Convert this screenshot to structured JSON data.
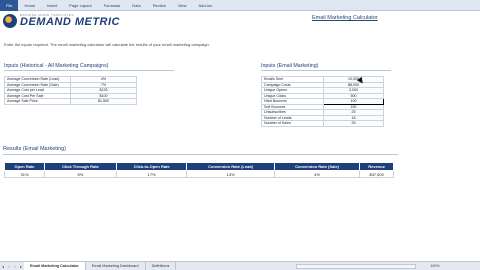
{
  "ribbon": {
    "tabs": [
      "File",
      "Home",
      "Insert",
      "Page Layout",
      "Formulas",
      "Data",
      "Review",
      "View",
      "Add-Ins"
    ]
  },
  "logo": {
    "tagline": "BROWSE MORE TEMPLATES",
    "name": "DEMAND METRIC"
  },
  "header": {
    "title": "Email Marketing Calculator",
    "intro": "Enter the inputs required. The email marketing calculator will calculate the results of your email marketing campaign."
  },
  "historical": {
    "title": "Inputs (Historical - All Marketing Campaigns)",
    "rows": [
      {
        "label": "Average Conversion Rate (Lead)",
        "value": "4%"
      },
      {
        "label": "Average Conversion Rate (Sale)",
        "value": "7%"
      },
      {
        "label": "Average Cost per Lead",
        "value": "$125"
      },
      {
        "label": "Average Cost Per Sale",
        "value": "$100"
      },
      {
        "label": "Average Sale Price",
        "value": "$1,500"
      }
    ]
  },
  "email_inputs": {
    "title": "Inputs (Email Marketing)",
    "rows": [
      {
        "label": "Emails Sent",
        "value": "10,000"
      },
      {
        "label": "Campaign Costs",
        "value": "$8,000"
      },
      {
        "label": "Unique Opens",
        "value": "3,000"
      },
      {
        "label": "Unique Clicks",
        "value": "500"
      },
      {
        "label": "Hard Bounces",
        "value": "100"
      },
      {
        "label": "Soft Bounces",
        "value": "150"
      },
      {
        "label": "Unsubscribes",
        "value": "25"
      },
      {
        "label": "Number of Leads",
        "value": "18"
      },
      {
        "label": "Number of Sales",
        "value": "25"
      }
    ]
  },
  "results": {
    "title": "Results (Email Marketing)",
    "headers": [
      "Open Rate",
      "Click Through Rate",
      "Click-to-Open Rate",
      "Conversion Rate (Lead)",
      "Conversion Rate (Sale)",
      "Revenue"
    ],
    "values": [
      "31%",
      "5%",
      "17%",
      "13%",
      "4%",
      "$37,500"
    ]
  },
  "sheets": {
    "tabs": [
      "Email Marketing Calculator",
      "Email Marketing Dashboard",
      "Definitions"
    ],
    "zoom": "100%"
  }
}
